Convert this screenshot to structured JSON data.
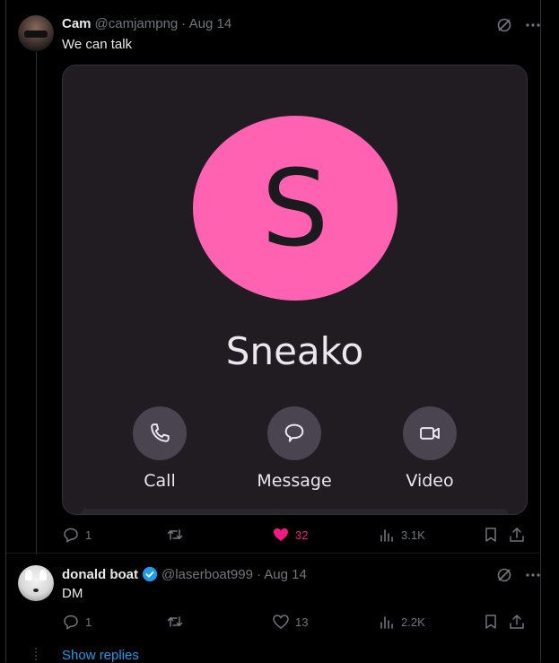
{
  "tweets": [
    {
      "name": "Cam",
      "handle": "@camjampng",
      "date": "· Aug 14",
      "text": "We can talk",
      "card": {
        "initial": "S",
        "contact_name": "Sneako",
        "actions": [
          {
            "label": "Call",
            "icon": "phone-icon"
          },
          {
            "label": "Message",
            "icon": "chat-bubble-icon"
          },
          {
            "label": "Video",
            "icon": "video-camera-icon"
          }
        ],
        "circle_color": "#ff62b0"
      },
      "stats": {
        "replies": "1",
        "likes": "32",
        "views": "3.1K"
      }
    },
    {
      "name": "donald boat",
      "verified": true,
      "handle": "@laserboat999",
      "date": "· Aug 14",
      "text": "DM",
      "stats": {
        "replies": "1",
        "likes": "13",
        "views": "2.2K"
      }
    }
  ],
  "show_replies": "Show replies",
  "colors": {
    "like": "#f91880",
    "link": "#1d9bf0",
    "verified": "#1d9bf0",
    "muted": "#71767b"
  }
}
